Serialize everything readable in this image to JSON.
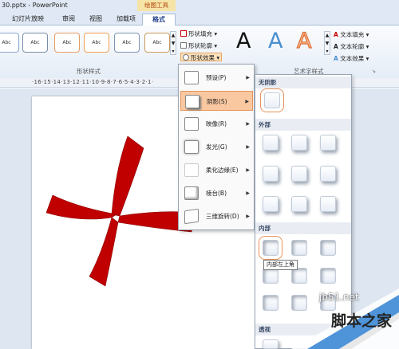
{
  "title_bar": {
    "title": "30.pptx - PowerPoint",
    "context_tab": "绘图工具"
  },
  "tabs": [
    {
      "label": "幻灯片放映"
    },
    {
      "label": "审阅"
    },
    {
      "label": "视图"
    },
    {
      "label": "加载项"
    },
    {
      "label": "格式"
    }
  ],
  "shape_styles": {
    "swatch_label": "Abc",
    "group_label": "形状样式"
  },
  "shape_buttons": {
    "fill": "形状填充",
    "outline": "形状轮廓",
    "effects": "形状效果"
  },
  "wordart": {
    "letter": "A",
    "text_fill": "文本填充",
    "text_outline": "文本轮廓",
    "text_effects": "文本效果",
    "group_label": "艺术字样式"
  },
  "ruler": {
    "text": "·16·15·14·13·12·11·10·9·8·7·6·5·4·3·2·1·"
  },
  "effects_menu": [
    {
      "label": "预设(P)",
      "highlighted": false
    },
    {
      "label": "阴影(S)",
      "highlighted": true
    },
    {
      "label": "映像(R)",
      "highlighted": false
    },
    {
      "label": "发光(G)",
      "highlighted": false
    },
    {
      "label": "柔化边缘(E)",
      "highlighted": false
    },
    {
      "label": "棱台(B)",
      "highlighted": false
    },
    {
      "label": "三维旋转(D)",
      "highlighted": false
    }
  ],
  "shadow_gallery": {
    "sections": {
      "none": "无阴影",
      "outer": "外部",
      "inner": "内部",
      "perspective": "透视"
    },
    "tooltip": "内部左上角"
  },
  "colors": {
    "shape_red": "#c00000",
    "highlight": "#f9c8a1",
    "ribbon_bg": "#dfe8f4"
  },
  "watermark": {
    "url": "jb51.net",
    "text": "脚本之家"
  }
}
